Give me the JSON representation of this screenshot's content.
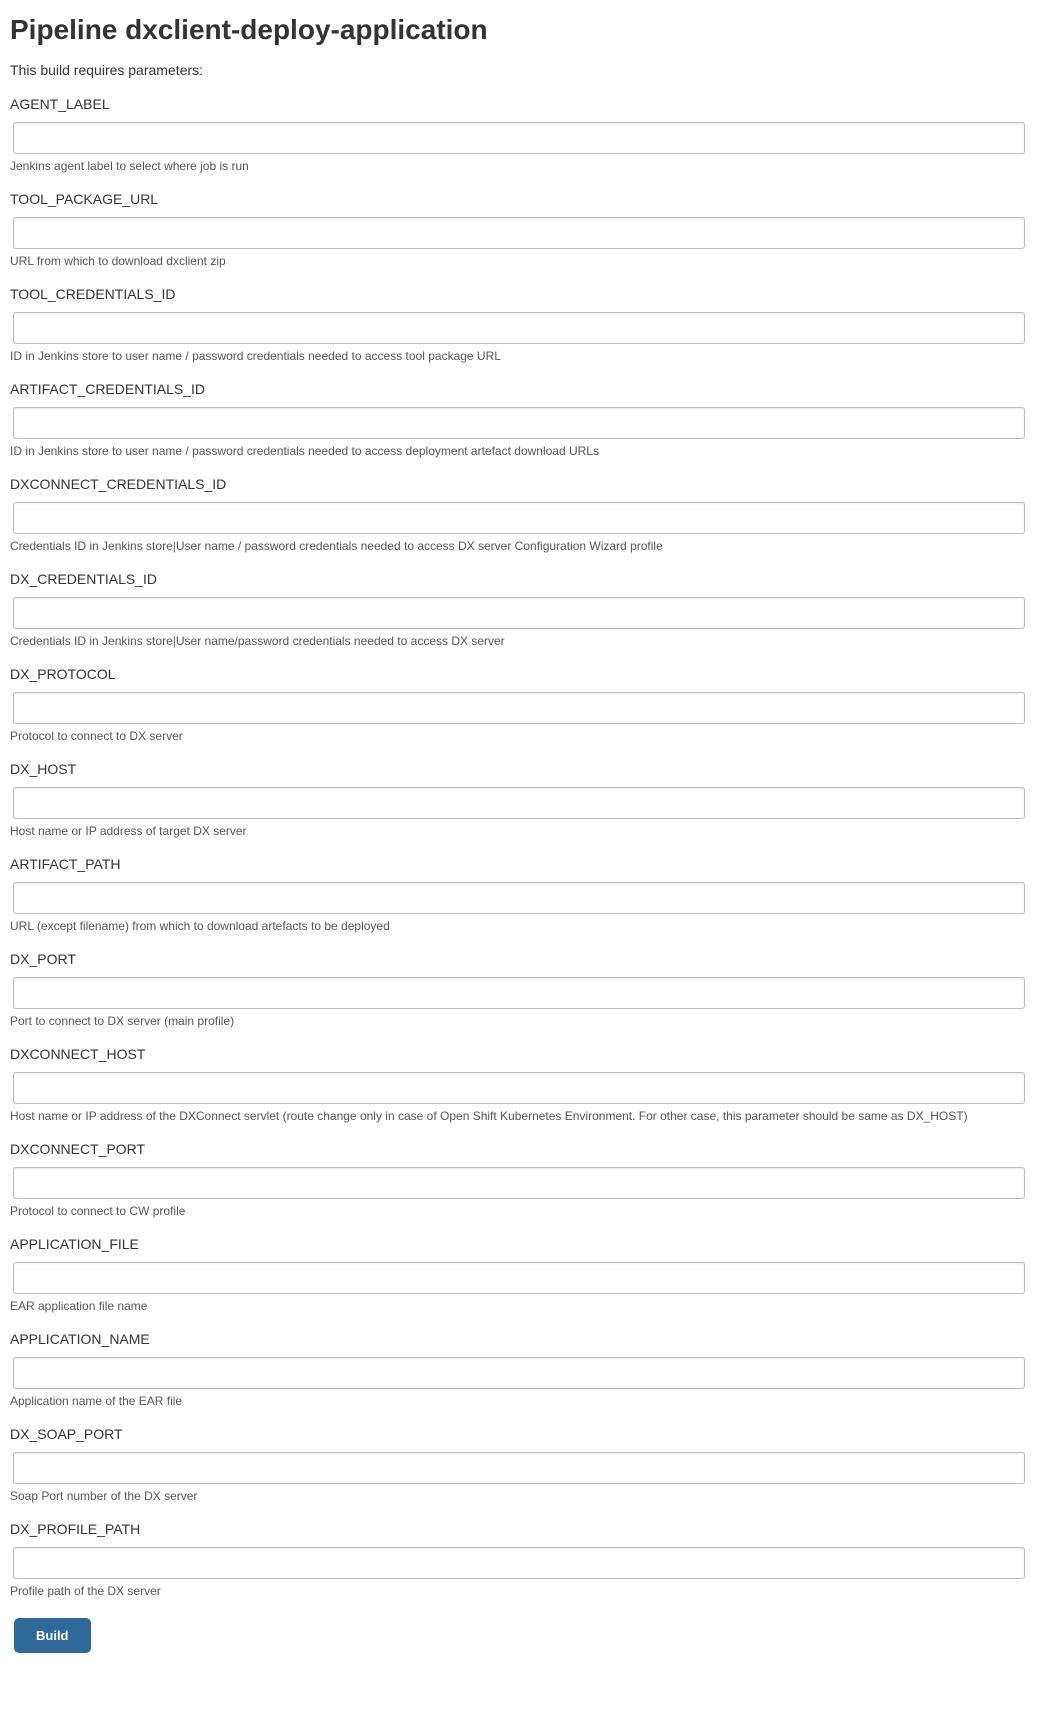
{
  "title": "Pipeline dxclient-deploy-application",
  "intro": "This build requires parameters:",
  "params": [
    {
      "label": "AGENT_LABEL",
      "value": "",
      "help": "Jenkins agent label to select where job is run"
    },
    {
      "label": "TOOL_PACKAGE_URL",
      "value": "",
      "help": "URL from which to download dxclient zip"
    },
    {
      "label": "TOOL_CREDENTIALS_ID",
      "value": "",
      "help": "ID in Jenkins store to user name / password credentials needed to access tool package URL"
    },
    {
      "label": "ARTIFACT_CREDENTIALS_ID",
      "value": "",
      "help": "ID in Jenkins store to user name / password credentials needed to access deployment artefact download URLs"
    },
    {
      "label": "DXCONNECT_CREDENTIALS_ID",
      "value": "",
      "help": "Credentials ID in Jenkins store|User name / password credentials needed to access DX server Configuration Wizard profile"
    },
    {
      "label": "DX_CREDENTIALS_ID",
      "value": "",
      "help": "Credentials ID in Jenkins store|User name/password credentials needed to access DX server"
    },
    {
      "label": "DX_PROTOCOL",
      "value": "",
      "help": "Protocol to connect to DX server"
    },
    {
      "label": "DX_HOST",
      "value": "",
      "help": "Host name or IP address of target DX server"
    },
    {
      "label": "ARTIFACT_PATH",
      "value": "",
      "help": "URL (except filename) from which to download artefacts to be deployed"
    },
    {
      "label": "DX_PORT",
      "value": "",
      "help": "Port to connect to DX server (main profile)"
    },
    {
      "label": "DXCONNECT_HOST",
      "value": "",
      "help": "Host name or IP address of the DXConnect servlet (route change only in case of Open Shift Kubernetes Environment. For other case, this parameter should be same as DX_HOST)"
    },
    {
      "label": "DXCONNECT_PORT",
      "value": "",
      "help": "Protocol to connect to CW profile"
    },
    {
      "label": "APPLICATION_FILE",
      "value": "",
      "help": "EAR application file name"
    },
    {
      "label": "APPLICATION_NAME",
      "value": "",
      "help": "Application name of the EAR file"
    },
    {
      "label": "DX_SOAP_PORT",
      "value": "",
      "help": "Soap Port number of the DX server"
    },
    {
      "label": "DX_PROFILE_PATH",
      "value": "",
      "help": "Profile path of the DX server"
    }
  ],
  "build_button_label": "Build"
}
